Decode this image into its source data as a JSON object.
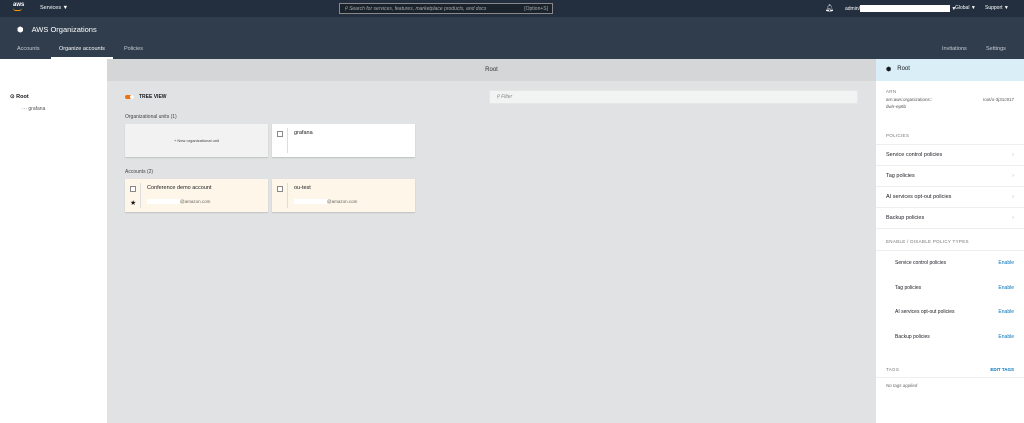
{
  "topbar": {
    "logo": "aws",
    "services": "Services ▼",
    "search_placeholder": "Search for services, features, marketplace products, and docs",
    "search_shortcut": "[Option+S]",
    "admin": "admin/",
    "global": "Global ▼",
    "support": "Support ▼"
  },
  "app": {
    "title": "AWS Organizations",
    "tabs": [
      "Accounts",
      "Organize accounts",
      "Policies"
    ],
    "right_tabs": [
      "Invitations",
      "Settings"
    ]
  },
  "tree": {
    "root": "Root",
    "child": "grafana"
  },
  "center": {
    "title": "Root",
    "tree_view": "TREE VIEW",
    "filter_placeholder": "Filter",
    "ou_header": "Organizational units (1)",
    "new_ou": "+ New organizational unit",
    "ou_name": "grafana",
    "accounts_header": "Accounts (2)",
    "accounts": [
      {
        "name": "Conference demo account",
        "email": "@amazon.com"
      },
      {
        "name": "ou-test",
        "email": "@amazon.com"
      }
    ]
  },
  "details": {
    "title": "Root",
    "arn_label": "ARN",
    "arn_1": "arn:aws:organizations::",
    "arn_2": "root/o-3j31c917",
    "arn_3": "dw/r-ep6b",
    "policies_label": "POLICIES",
    "policies": [
      "Service control policies",
      "Tag policies",
      "AI services opt-out policies",
      "Backup policies"
    ],
    "enable_label": "ENABLE / DISABLE POLICY TYPES",
    "enable_action": "Enable",
    "tags_label": "TAGS",
    "edit_tags": "EDIT TAGS",
    "no_tags": "No tags applied"
  }
}
